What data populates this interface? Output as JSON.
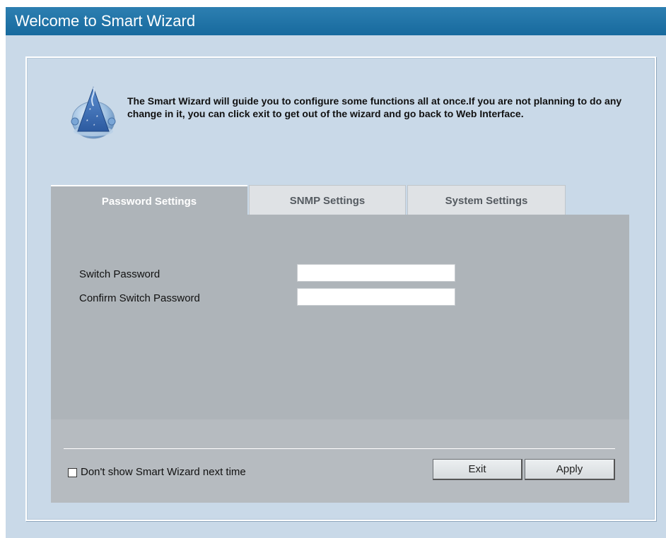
{
  "window": {
    "title": "Welcome to Smart Wizard"
  },
  "intro": {
    "text": "The Smart Wizard will guide you to configure some functions all at once.If you are not planning to do any change in it, you can click exit to get out of the wizard and go back to Web Interface."
  },
  "tabs": [
    {
      "label": "Password Settings",
      "active": true
    },
    {
      "label": "SNMP Settings",
      "active": false
    },
    {
      "label": "System Settings",
      "active": false
    }
  ],
  "form": {
    "switch_password_label": "Switch Password",
    "switch_password_value": "",
    "confirm_password_label": "Confirm Switch Password",
    "confirm_password_value": ""
  },
  "footer": {
    "checkbox_label": "Don't show Smart Wizard next time",
    "checkbox_checked": false,
    "exit_label": "Exit",
    "apply_label": "Apply"
  },
  "colors": {
    "title_bar": "#1f74a8",
    "panel_background": "#c9d9e8",
    "tab_active": "#aeb4b9",
    "tab_inactive": "#dfe2e5"
  },
  "icons": {
    "wizard": "wizard-hat-icon"
  }
}
